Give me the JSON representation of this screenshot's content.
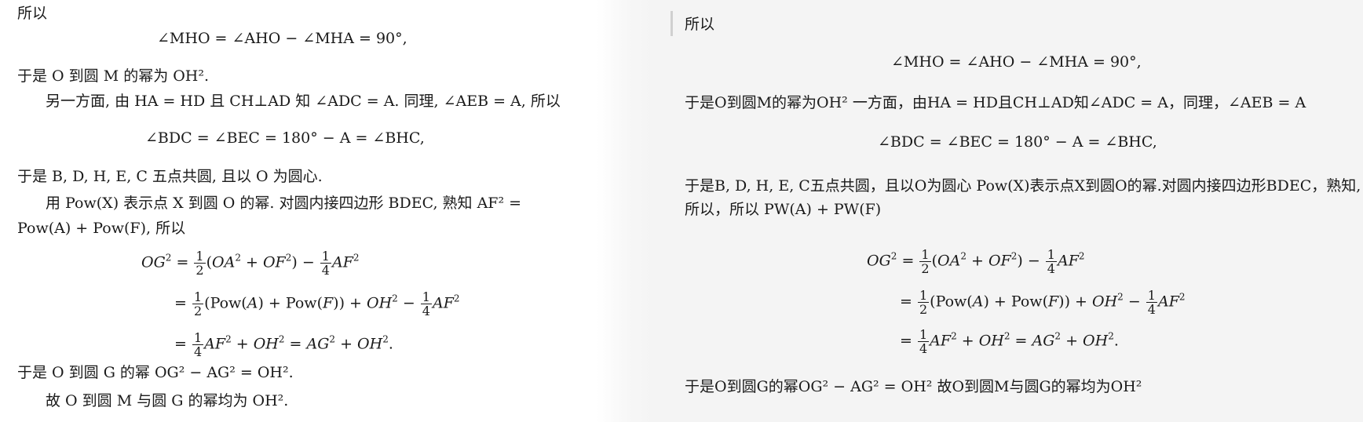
{
  "left": {
    "l1": "所以",
    "eq1": "∠MHO = ∠AHO − ∠MHA = 90°,",
    "l2": "于是 O 到圆 M 的幂为 OH².",
    "l3": "另一方面, 由 HA = HD 且 CH⊥AD 知 ∠ADC = A. 同理, ∠AEB = A, 所以",
    "eq2": "∠BDC = ∠BEC = 180° − A = ∠BHC,",
    "l4": "于是 B, D, H, E, C 五点共圆, 且以 O 为圆心.",
    "l5": "用 Pow(X) 表示点 X 到圆 O 的幂. 对圆内接四边形 BDEC, 熟知 AF² =",
    "l6": "Pow(A) + Pow(F), 所以",
    "l7": "于是 O 到圆 G 的幂 OG² − AG² = OH².",
    "l8": "故 O 到圆 M 与圆 G 的幂均为 OH²."
  },
  "right": {
    "l1": "所以",
    "eq1": "∠MHO = ∠AHO − ∠MHA = 90°,",
    "l2": "于是O到圆M的幂为OH² 一方面，由HA = HD且CH⊥AD知∠ADC = A，同理，∠AEB = A",
    "eq2": "∠BDC = ∠BEC = 180° − A = ∠BHC,",
    "l3": "于是B, D, H, E, C五点共圆，且以O为圆心 Pow(X)表示点X到圆O的幂.对圆内接四边形BDEC，熟知,",
    "l4": "所以，所以 PW(A) + PW(F)",
    "l5": "于是O到圆G的幂OG² − AG² = OH² 故O到圆M与圆G的幂均为OH²"
  }
}
